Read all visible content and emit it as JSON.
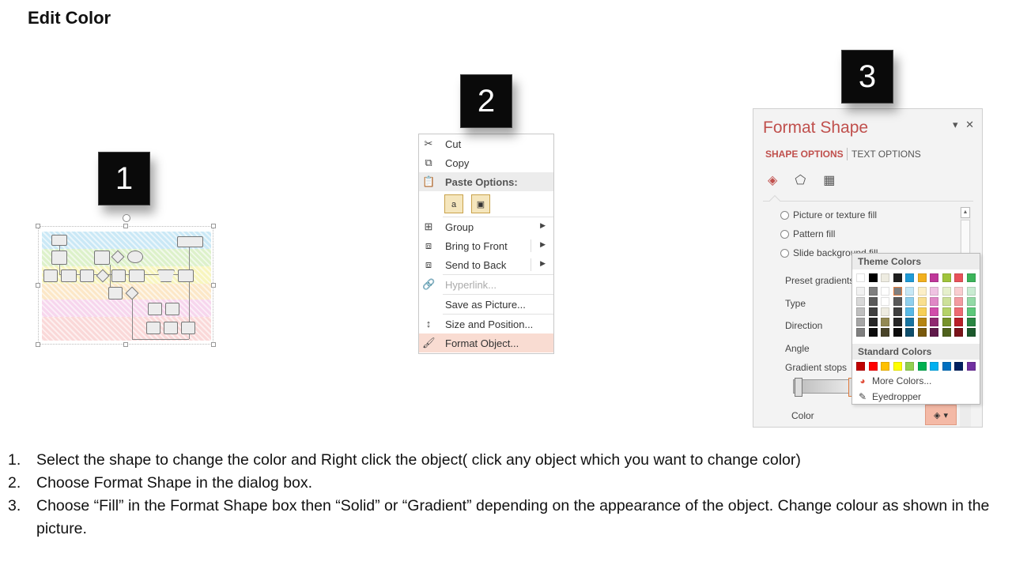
{
  "page": {
    "title": "Edit Color"
  },
  "steps": {
    "one": "1",
    "two": "2",
    "three": "3"
  },
  "context_menu": {
    "items": [
      {
        "label": "Cut",
        "icon": "scissors-icon"
      },
      {
        "label": "Copy",
        "icon": "copy-icon"
      },
      {
        "label": "Paste Options:",
        "icon": "paste-icon"
      },
      {
        "label": "Group",
        "icon": "group-icon"
      },
      {
        "label": "Bring to Front",
        "icon": "bring-front-icon"
      },
      {
        "label": "Send to Back",
        "icon": "send-back-icon"
      },
      {
        "label": "Hyperlink...",
        "icon": "hyperlink-icon"
      },
      {
        "label": "Save as Picture...",
        "icon": ""
      },
      {
        "label": "Size and Position...",
        "icon": "size-position-icon"
      },
      {
        "label": "Format Object...",
        "icon": "format-object-icon"
      }
    ],
    "paste_a": "a"
  },
  "format_pane": {
    "title": "Format Shape",
    "tab_shape": "SHAPE OPTIONS",
    "tab_text": "TEXT OPTIONS",
    "radios": [
      "Picture or texture fill",
      "Pattern fill",
      "Slide background fill"
    ],
    "props": {
      "preset_gradients": "Preset gradients",
      "type": "Type",
      "direction": "Direction",
      "angle": "Angle",
      "gradient_stops": "Gradient stops",
      "color": "Color"
    }
  },
  "color_picker": {
    "theme_header": "Theme Colors",
    "standard_header": "Standard Colors",
    "more_colors": "More Colors...",
    "eyedropper": "Eyedropper",
    "theme_top": [
      "#ffffff",
      "#000000",
      "#eeece1",
      "#1f1f1f",
      "#1f9ad6",
      "#f2b01e",
      "#c0389a",
      "#a0c43c",
      "#e8525a",
      "#3cb45a"
    ],
    "theme_shades": [
      [
        "#f2f2f2",
        "#7f7f7f",
        "#ffffff",
        "#7f7f7f",
        "#c7e8f6",
        "#fcefc7",
        "#efc3e2",
        "#e6f0cc",
        "#f9cdd0",
        "#c9ecd2"
      ],
      [
        "#d8d8d8",
        "#595959",
        "#ffffff",
        "#595959",
        "#8fd0ee",
        "#f9df8f",
        "#e088c6",
        "#cde19a",
        "#f39ba1",
        "#93daa6"
      ],
      [
        "#bfbfbf",
        "#3f3f3f",
        "#eeece1",
        "#3f3f3f",
        "#57b9e6",
        "#f6cf57",
        "#d14daa",
        "#b4d268",
        "#ed6a72",
        "#5dc87a"
      ],
      [
        "#a5a5a5",
        "#262626",
        "#938953",
        "#262626",
        "#1673a0",
        "#b58412",
        "#902870",
        "#76922a",
        "#b81f28",
        "#2a8642"
      ],
      [
        "#7f7f7f",
        "#0c0c0c",
        "#494429",
        "#0c0c0c",
        "#0e4d6b",
        "#78580c",
        "#601a4a",
        "#4f611c",
        "#7a141a",
        "#1c592c"
      ]
    ],
    "standard": [
      "#c00000",
      "#ff0000",
      "#ffc000",
      "#ffff00",
      "#92d050",
      "#00b050",
      "#00b0f0",
      "#0070c0",
      "#002060",
      "#7030a0"
    ]
  },
  "instructions": [
    {
      "num": "1.",
      "text": "Select the shape to change the color and Right click the object( click any object which you want to change color)"
    },
    {
      "num": "2.",
      "text": "Choose Format Shape in the dialog box."
    },
    {
      "num": "3.",
      "text": "Choose “Fill” in the Format Shape box then “Solid” or “Gradient” depending on the appearance of the object. Change colour as shown in the picture."
    }
  ]
}
